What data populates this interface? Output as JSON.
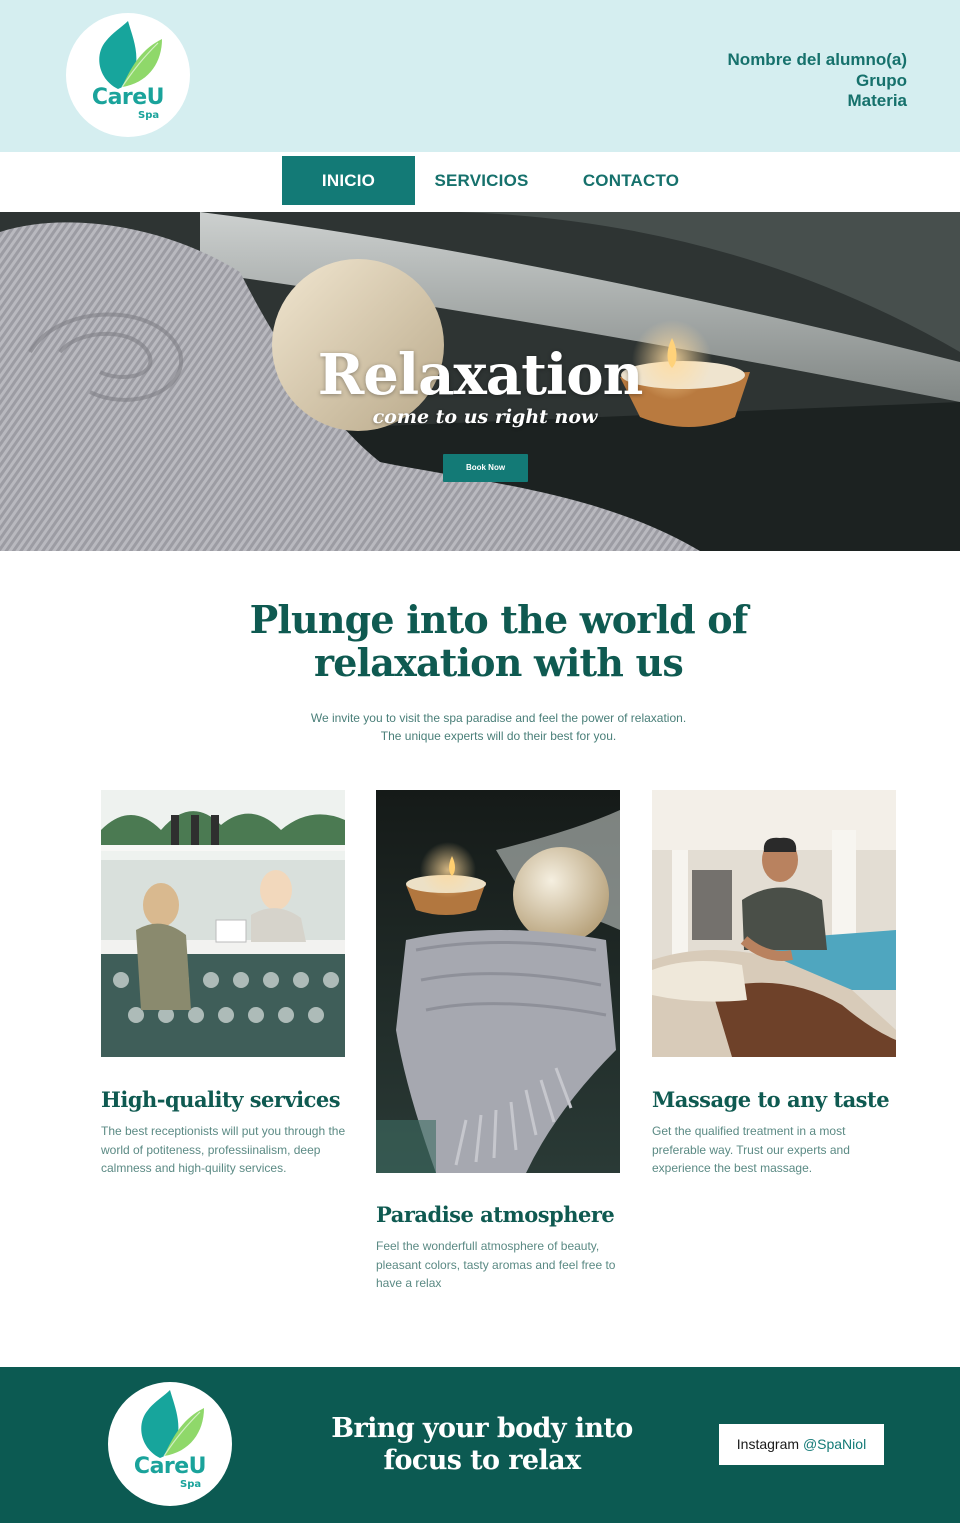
{
  "brand": {
    "name": "CareU",
    "sub": "Spa",
    "leaf_colors": [
      "#17a59c",
      "#8fd86a"
    ]
  },
  "header": {
    "student_lines": [
      "Nombre del alumno(a)",
      "Grupo",
      "Materia"
    ]
  },
  "nav": {
    "items": [
      {
        "label": "INICIO",
        "active": true
      },
      {
        "label": "SERVICIOS",
        "active": false
      },
      {
        "label": "CONTACTO",
        "active": false
      }
    ]
  },
  "hero": {
    "title": "Relaxation",
    "subtitle": "come to us right now",
    "button_label": "Book Now"
  },
  "intro": {
    "title_lines": [
      "Plunge into the world of",
      "relaxation with us"
    ],
    "text_lines": [
      "We invite you to visit the spa paradise and feel the power of relaxation.",
      "The unique experts will do their best for you."
    ]
  },
  "cards": [
    {
      "title": "High-quality services",
      "text_lines": [
        "The best receptionists will put you through the",
        "world of potiteness, professiinalism, deep",
        "calmness and high-quility services."
      ],
      "image": "spa-reception-photo"
    },
    {
      "title": "Paradise atmosphere",
      "text_lines": [
        "Feel the wonderfull atmosphere of beauty,",
        "pleasant colors, tasty aromas and feel free to",
        "have a relax"
      ],
      "image": "candle-bath-bomb-towel-photo"
    },
    {
      "title": "Massage to any taste",
      "text_lines": [
        "Get the qualified treatment in a most",
        "preferable way. Trust our experts and",
        "experience the best massage."
      ],
      "image": "poolside-massage-photo"
    }
  ],
  "footer": {
    "tagline_lines": [
      "Bring your body into",
      "focus to relax"
    ],
    "instagram_label": "Instagram",
    "instagram_handle": "@SpaNiol"
  },
  "colors": {
    "primary": "#137a76",
    "dark_green": "#0c5a52",
    "header_bg": "#d5eef0"
  }
}
